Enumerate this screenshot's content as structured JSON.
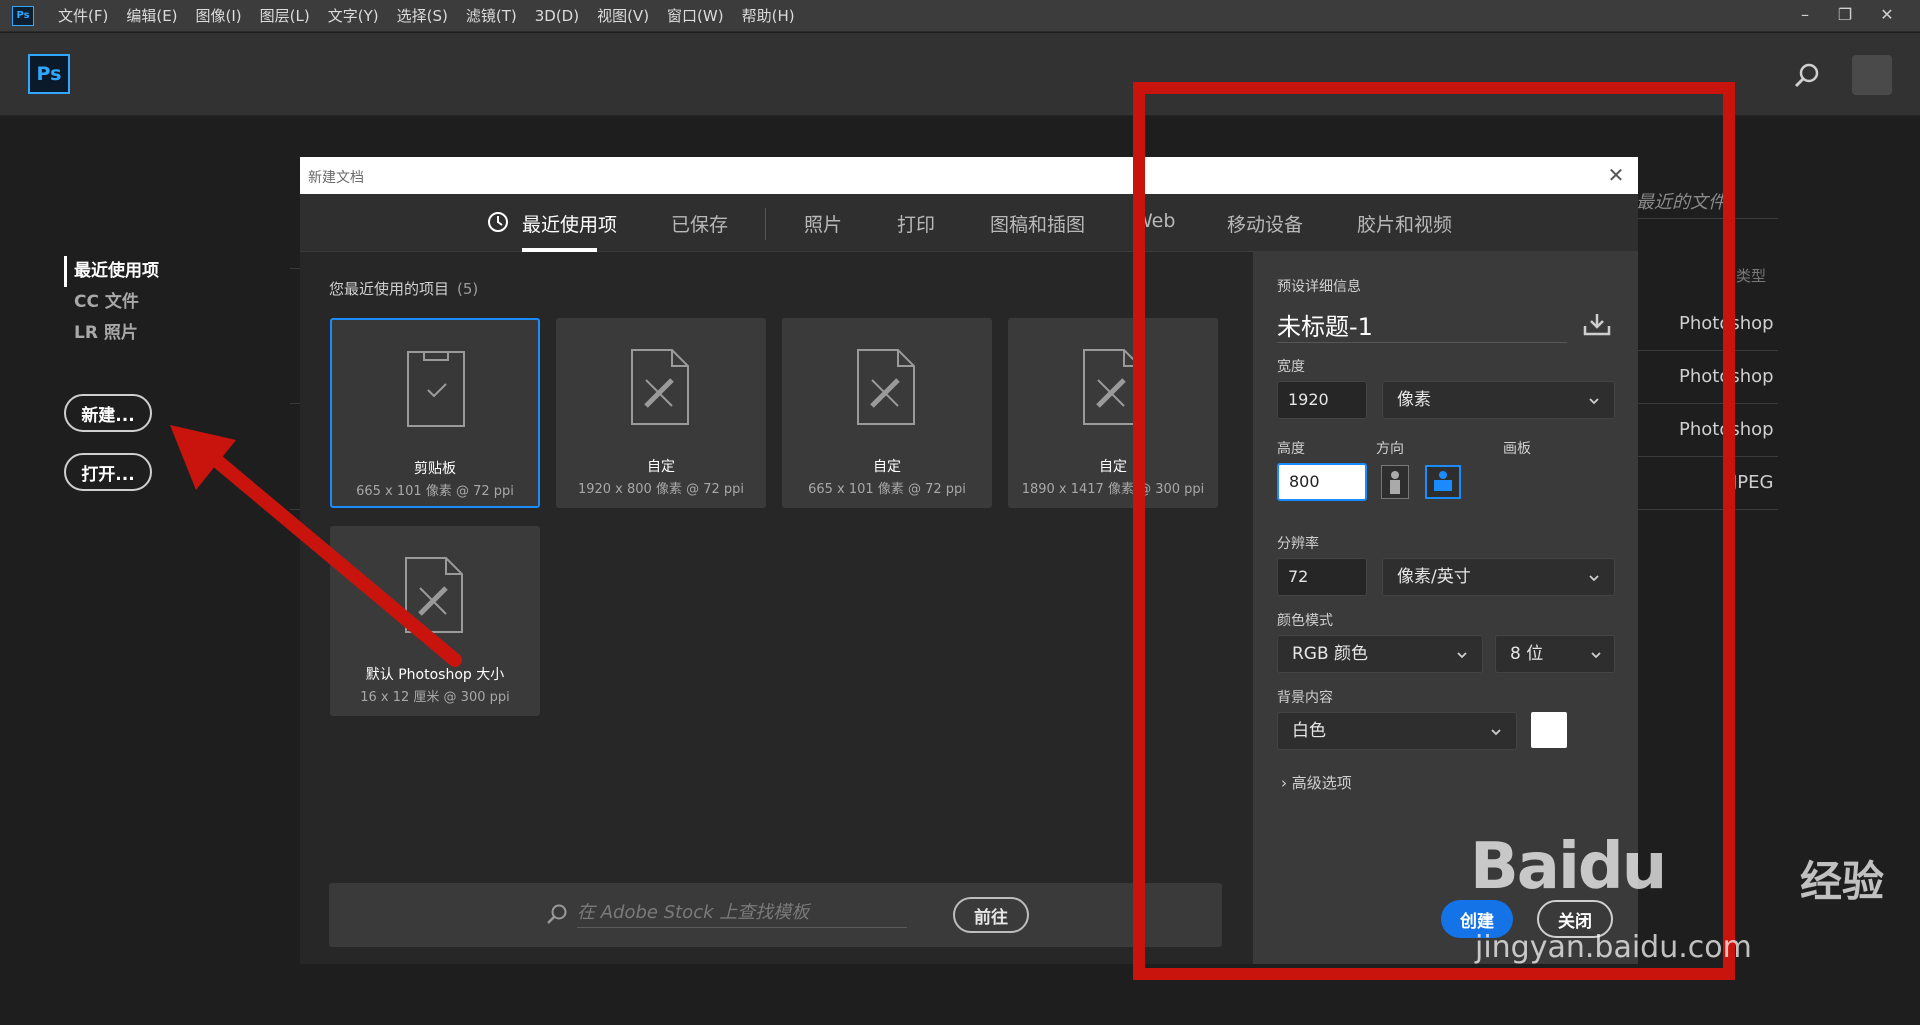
{
  "menubar": {
    "logo": "Ps",
    "items": [
      "文件(F)",
      "编辑(E)",
      "图像(I)",
      "图层(L)",
      "文字(Y)",
      "选择(S)",
      "滤镜(T)",
      "3D(D)",
      "视图(V)",
      "窗口(W)",
      "帮助(H)"
    ]
  },
  "appbar": {
    "logo": "Ps"
  },
  "home": {
    "nav": [
      "最近使用项",
      "CC 文件",
      "LR 照片"
    ],
    "new_button": "新建...",
    "open_button": "打开..."
  },
  "background": {
    "recent_files_title": "最近的文件",
    "type_header": "类型",
    "rows": [
      "Photoshop",
      "Photoshop",
      "Photoshop",
      "JPEG"
    ]
  },
  "dialog": {
    "title": "新建文档",
    "close": "✕",
    "tabs": [
      "最近使用项",
      "已保存",
      "照片",
      "打印",
      "图稿和插图",
      "Web",
      "移动设备",
      "胶片和视频"
    ],
    "recent_label": "您最近使用的项目",
    "recent_count": "(5)",
    "cards": [
      {
        "name": "剪贴板",
        "size": "665 x 101 像素 @ 72 ppi"
      },
      {
        "name": "自定",
        "size": "1920 x 800 像素 @ 72 ppi"
      },
      {
        "name": "自定",
        "size": "665 x 101 像素 @ 72 ppi"
      },
      {
        "name": "自定",
        "size": "1890 x 1417 像素 @ 300 ppi"
      },
      {
        "name": "默认 Photoshop 大小",
        "size": "16 x 12 厘米 @ 300 ppi"
      }
    ],
    "stock": {
      "placeholder": "在 Adobe Stock 上查找模板",
      "go_button": "前往"
    },
    "details": {
      "section_title": "预设详细信息",
      "doc_name": "未标题-1",
      "width_label": "宽度",
      "width_value": "1920",
      "width_unit": "像素",
      "height_label": "高度",
      "height_value": "800",
      "orientation_label": "方向",
      "artboard_label": "画板",
      "resolution_label": "分辨率",
      "resolution_value": "72",
      "resolution_unit": "像素/英寸",
      "color_mode_label": "颜色模式",
      "color_mode": "RGB 颜色",
      "bit_depth": "8 位",
      "background_label": "背景内容",
      "background_value": "白色",
      "background_color": "#ffffff",
      "advanced": "高级选项"
    },
    "create_button": "创建",
    "close_button": "关闭"
  },
  "watermark": {
    "brand": "Baidu",
    "brand_cn": "经验",
    "url": "jingyan.baidu.com"
  },
  "colors": {
    "accent": "#1473e6",
    "selected_border": "#1a8cff",
    "annotation_red": "#c9140e"
  }
}
